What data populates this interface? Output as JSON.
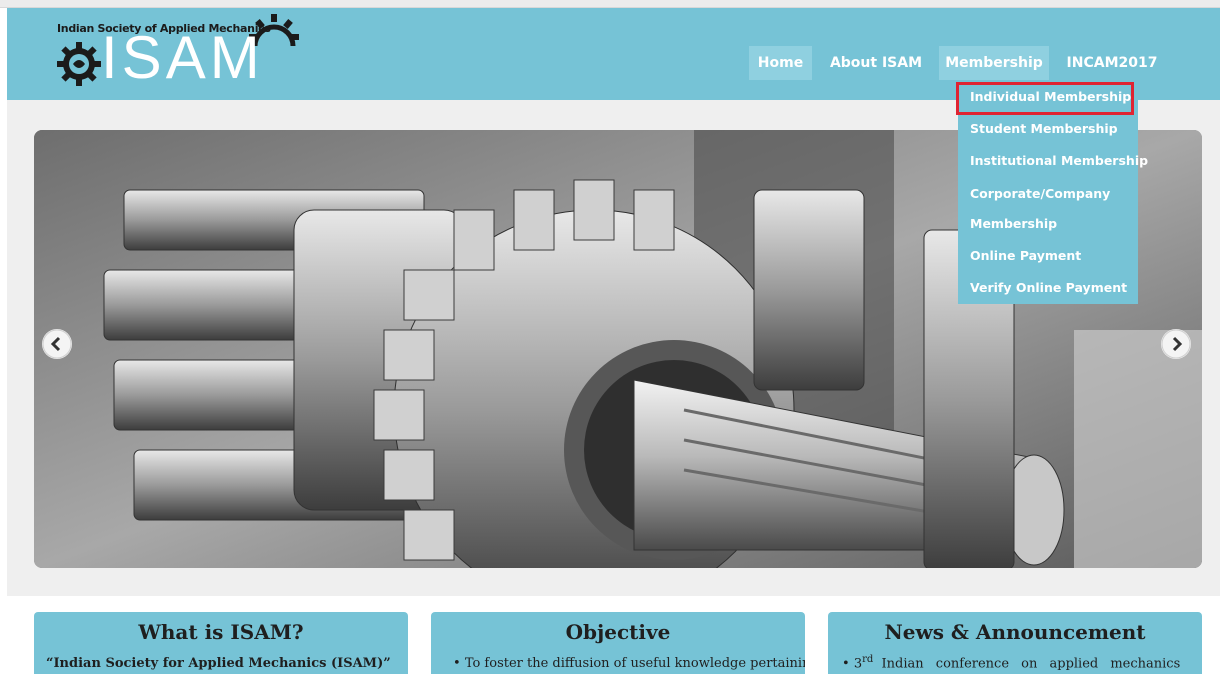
{
  "header": {
    "org_full_name": "Indian Society of Applied Mechanics",
    "org_short": "ISAM"
  },
  "nav": {
    "items": [
      {
        "label": "Home"
      },
      {
        "label": "About ISAM"
      },
      {
        "label": "Membership"
      },
      {
        "label": "INCAM2017"
      }
    ]
  },
  "dropdown": {
    "items": [
      {
        "label": "Individual Membership",
        "highlighted": true
      },
      {
        "label": "Student Membership"
      },
      {
        "label": "Institutional Membership"
      },
      {
        "label": "Corporate/Company"
      },
      {
        "label": "Membership"
      },
      {
        "label": "Online Payment"
      },
      {
        "label": "Verify Online Payment"
      }
    ]
  },
  "slider": {
    "image_subject": "machine gears photo"
  },
  "panels": [
    {
      "title": "What is ISAM?",
      "text": "“Indian Society for Applied Mechanics (ISAM)”"
    },
    {
      "title": "Objective",
      "text": "To foster the diffusion of useful knowledge pertaining"
    },
    {
      "title": "News & Announcement",
      "text_sup": "rd",
      "text_pre": "3",
      "text": "Indian conference on applied mechanics"
    }
  ],
  "colors": {
    "header_bg": "#76c3d6",
    "nav_active_bg": "#8fd0e0",
    "highlight_border": "#e02432",
    "page_bg": "#efefef"
  }
}
